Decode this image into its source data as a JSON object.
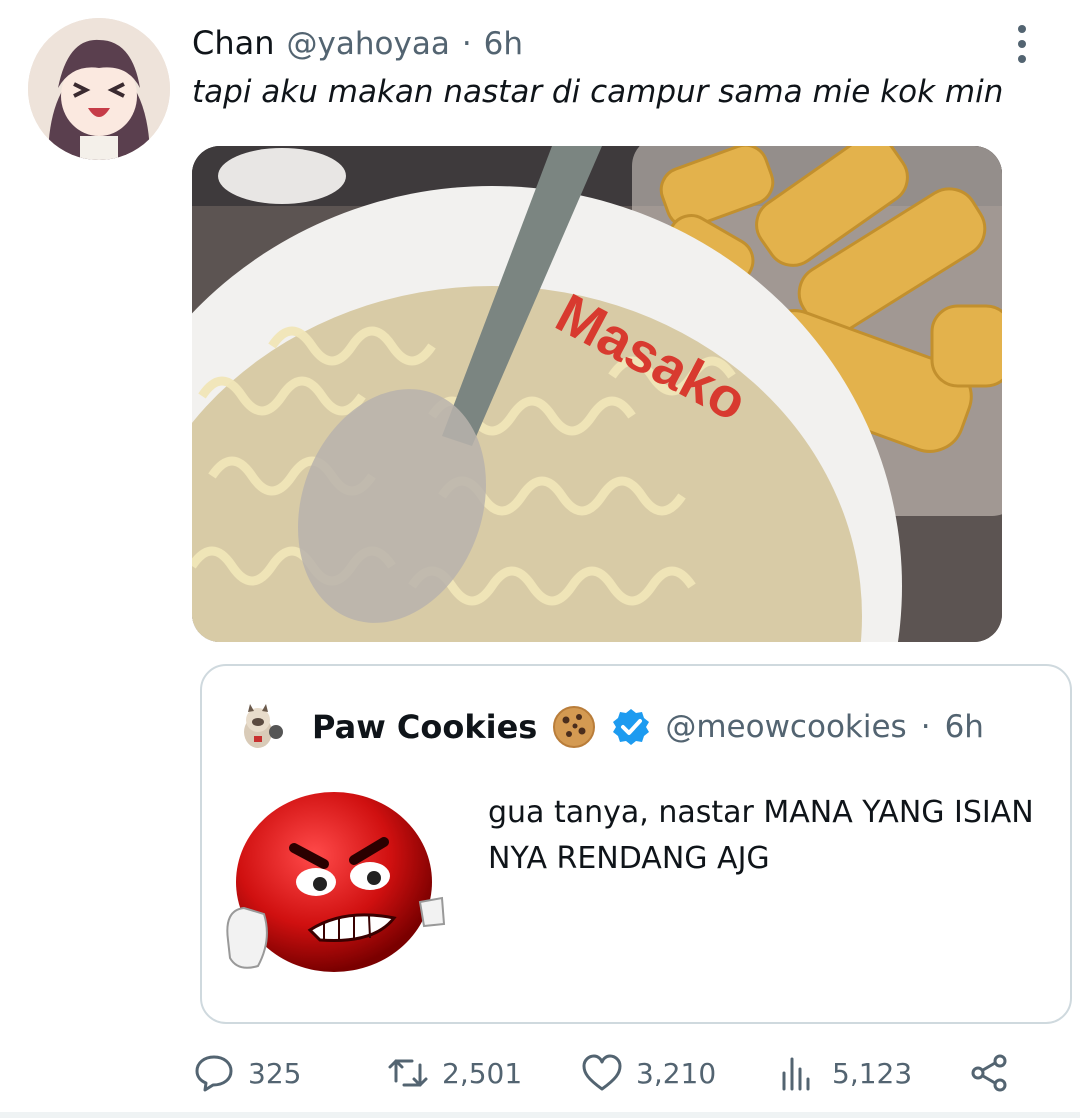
{
  "tweet": {
    "display_name": "Chan",
    "handle": "@yahoyaa",
    "separator": "·",
    "time": "6h",
    "text": "tapi aku makan nastar di campur sama mie kok min",
    "media_bowl_text": "Masako"
  },
  "quote": {
    "display_name": "Paw Cookies",
    "handle": "@meowcookies",
    "separator": "·",
    "time": "6h",
    "text": "gua tanya, nastar MANA YANG ISIAN NYA RENDANG AJG"
  },
  "actions": {
    "replies": "325",
    "retweets": "2,501",
    "likes": "3,210",
    "views": "5,123"
  },
  "colors": {
    "text": "#0f1419",
    "secondary": "#536471",
    "border": "#cfd9de",
    "verified": "#1d9bf0"
  },
  "icons": [
    "more-icon",
    "cookie-icon",
    "verified-icon",
    "reply-icon",
    "retweet-icon",
    "like-icon",
    "views-icon",
    "share-icon"
  ]
}
